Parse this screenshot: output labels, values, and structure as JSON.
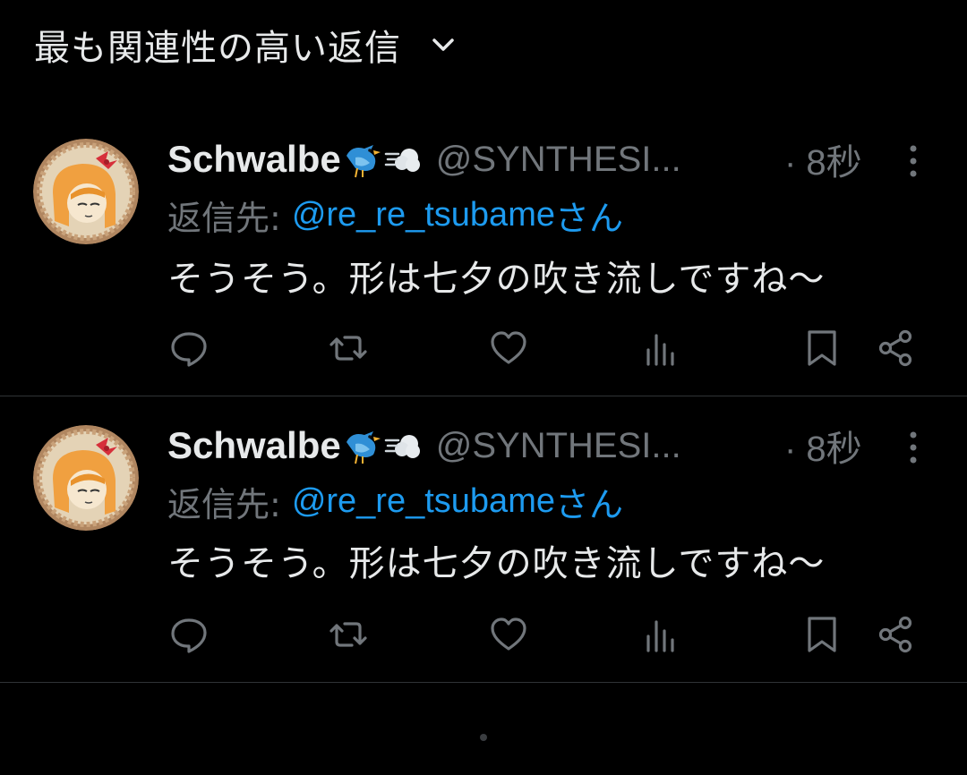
{
  "header": {
    "sort_label": "最も関連性の高い返信"
  },
  "tweets": [
    {
      "display_name": "Schwalbe",
      "name_emojis": [
        "bird-emoji",
        "dash-emoji"
      ],
      "handle": "@SYNTHESI...",
      "time": "· 8秒",
      "reply_prefix": "返信先:",
      "reply_user": "@re_re_tsubame",
      "reply_suffix": "さん",
      "text": "そうそう。形は七夕の吹き流しですね〜",
      "actions": [
        "reply-icon",
        "retweet-icon",
        "like-icon",
        "views-icon",
        "bookmark-icon",
        "share-icon"
      ]
    },
    {
      "display_name": "Schwalbe",
      "name_emojis": [
        "bird-emoji",
        "dash-emoji"
      ],
      "handle": "@SYNTHESI...",
      "time": "· 8秒",
      "reply_prefix": "返信先:",
      "reply_user": "@re_re_tsubame",
      "reply_suffix": "さん",
      "text": "そうそう。形は七夕の吹き流しですね〜",
      "actions": [
        "reply-icon",
        "retweet-icon",
        "like-icon",
        "views-icon",
        "bookmark-icon",
        "share-icon"
      ]
    }
  ],
  "colors": {
    "background": "#000000",
    "text_primary": "#e7e9ea",
    "text_secondary": "#71767b",
    "accent": "#1d9bf0",
    "divider": "#2f3336"
  }
}
